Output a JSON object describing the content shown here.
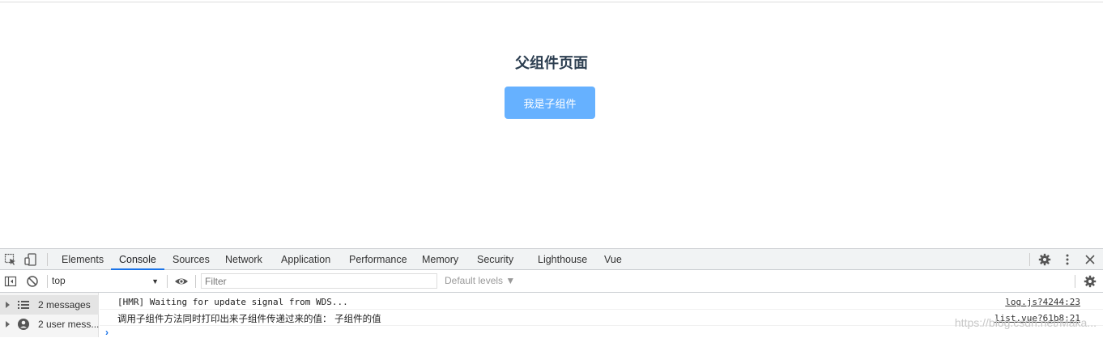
{
  "page": {
    "title": "父组件页面",
    "child_button": "我是子组件"
  },
  "devtools": {
    "tabs": [
      "Elements",
      "Console",
      "Sources",
      "Network",
      "Application",
      "Performance",
      "Memory",
      "Security",
      "Lighthouse",
      "Vue"
    ],
    "active_tab": "Console",
    "toolbar": {
      "context": "top",
      "filter_placeholder": "Filter",
      "levels": "Default levels ▼"
    },
    "sidebar": [
      {
        "label": "2 messages",
        "icon": "list-icon"
      },
      {
        "label": "2 user mess...",
        "icon": "user-icon"
      }
    ],
    "messages": [
      {
        "text": "[HMR] Waiting for update signal from WDS...",
        "source": "log.js?4244:23"
      },
      {
        "text": "调用子组件方法同时打印出来子组件传递过来的值： 子组件的值",
        "source": "list.vue?61b8:21"
      }
    ],
    "prompt": "›",
    "watermark": "https://blog.csdn.net/Maka..."
  },
  "colors": {
    "button_bg": "#66b1ff",
    "title_color": "#2c3e50",
    "active_tab_underline": "#1a73e8"
  }
}
